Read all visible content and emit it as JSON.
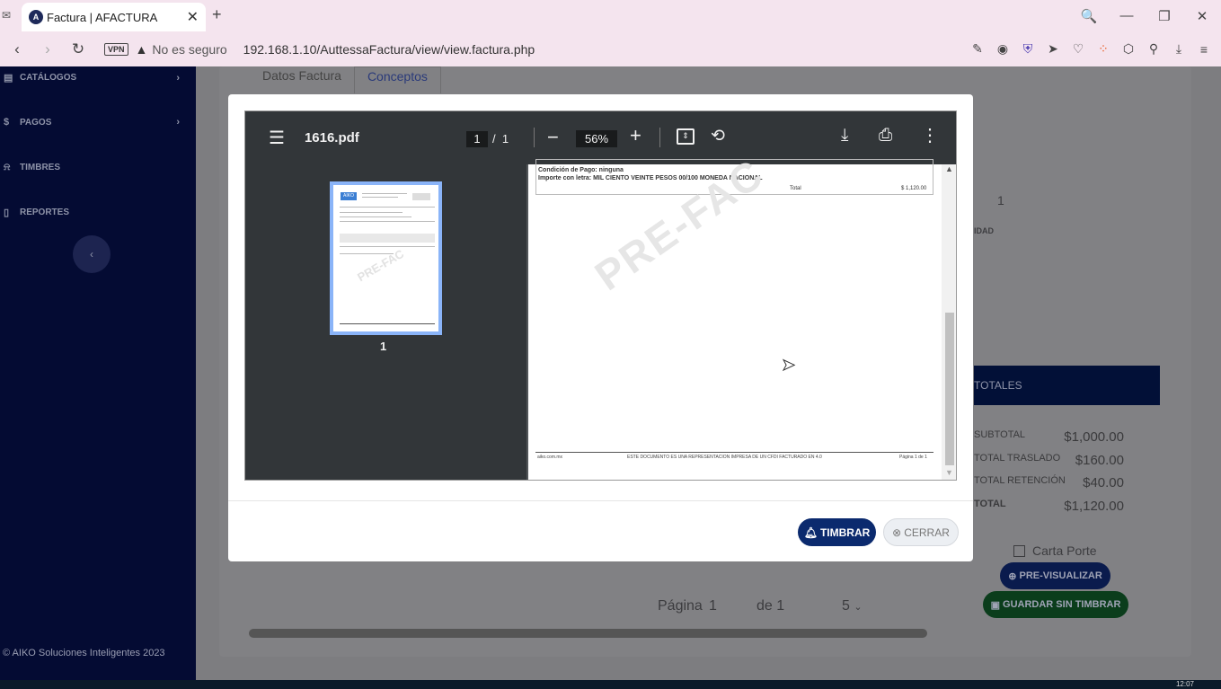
{
  "browser": {
    "tab_title": "Factura | AFACTURA",
    "tab_close": "✕",
    "new_tab": "+",
    "vpn": "VPN",
    "security_text": "No es seguro",
    "url": "192.168.1.10/AuttessaFactura/view/view.factura.php",
    "window_controls": [
      "🔍",
      "—",
      "❐",
      "✕"
    ]
  },
  "sidebar": {
    "items": [
      {
        "icon": "book-icon",
        "label": "CATÁLOGOS",
        "chev": "›"
      },
      {
        "icon": "dollar-icon",
        "label": "PAGOS",
        "chev": "›"
      },
      {
        "icon": "bell-icon",
        "label": "TIMBRES",
        "chev": ""
      },
      {
        "icon": "file-icon",
        "label": "REPORTES",
        "chev": ""
      }
    ],
    "collapse": "‹",
    "footer": "© AIKO Soluciones Inteligentes 2023"
  },
  "main": {
    "tabs": [
      "Datos Factura",
      "Conceptos"
    ],
    "qty_value": "1",
    "qty_label": "IDAD",
    "totales_title": "TOTALES",
    "totals": [
      {
        "label": "SUBTOTAL",
        "value": "$1,000.00"
      },
      {
        "label": "TOTAL TRASLADO",
        "value": "$160.00"
      },
      {
        "label": "TOTAL RETENCIÓN",
        "value": "$40.00"
      },
      {
        "label": "TOTAL",
        "value": "$1,120.00"
      }
    ],
    "carta_porte": "Carta Porte",
    "previsualizar": "PRE-VISUALIZAR",
    "guardar": "GUARDAR SIN TIMBRAR",
    "pagina_label": "Página",
    "pagina_num": "1",
    "de_label": "de 1",
    "page_size": "5",
    "taskbar_time": "12:07"
  },
  "modal": {
    "pdf": {
      "filename": "1616.pdf",
      "current_page": "1",
      "page_sep": "/",
      "total_pages": "1",
      "zoom": "56%",
      "thumb_number": "1",
      "condicion_pago": "Condición de Pago: ninguna",
      "importe_letra": "Importe con letra: MIL CIENTO VEINTE PESOS 00/100 MONEDA NACIONAL",
      "total_label": "Total",
      "total_value": "$ 1,120.00",
      "watermark": "PRE-FAC",
      "footer_left": "aiko.com.mx",
      "footer_center": "ESTE DOCUMENTO ES UNA REPRESENTACION IMPRESA DE UN CFDI FACTURADO EN 4.0",
      "footer_right": "Página 1 de 1",
      "thumb_logo": "AIKO",
      "thumb_watermark": "PRE-FAC"
    },
    "timbrar_label": "TIMBRAR",
    "cerrar_label": "CERRAR"
  }
}
